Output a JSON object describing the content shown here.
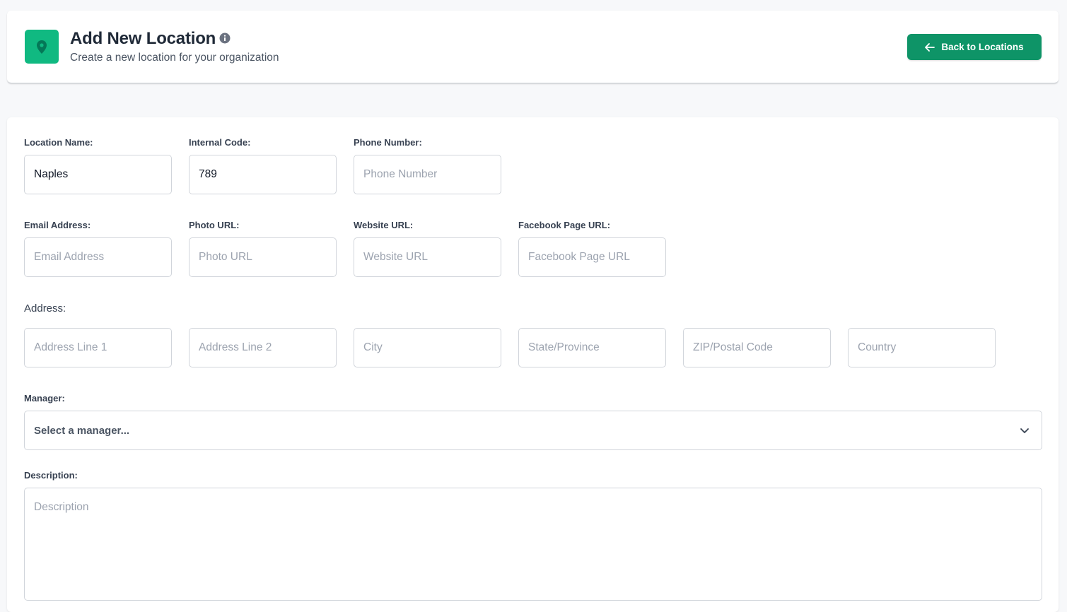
{
  "header": {
    "title": "Add New Location",
    "subtitle": "Create a new location for your organization",
    "back_label": "Back to Locations",
    "icons": {
      "badge": "map-pin-icon",
      "info": "info-icon",
      "back": "arrow-left-icon"
    },
    "colors": {
      "badge": "#10b981",
      "button": "#0e9467"
    }
  },
  "form": {
    "location_name": {
      "label": "Location Name:",
      "value": "Naples"
    },
    "internal_code": {
      "label": "Internal Code:",
      "value": "789"
    },
    "phone": {
      "label": "Phone Number:",
      "placeholder": "Phone Number"
    },
    "email": {
      "label": "Email Address:",
      "placeholder": "Email Address"
    },
    "photo_url": {
      "label": "Photo URL:",
      "placeholder": "Photo URL"
    },
    "website_url": {
      "label": "Website URL:",
      "placeholder": "Website URL"
    },
    "facebook_url": {
      "label": "Facebook Page URL:",
      "placeholder": "Facebook Page URL"
    },
    "address": {
      "label": "Address:",
      "line1": "Address Line 1",
      "line2": "Address Line 2",
      "city": "City",
      "state": "State/Province",
      "zip": "ZIP/Postal Code",
      "country": "Country"
    },
    "manager": {
      "label": "Manager:",
      "selected": "Select a manager..."
    },
    "description": {
      "label": "Description:",
      "placeholder": "Description"
    }
  }
}
